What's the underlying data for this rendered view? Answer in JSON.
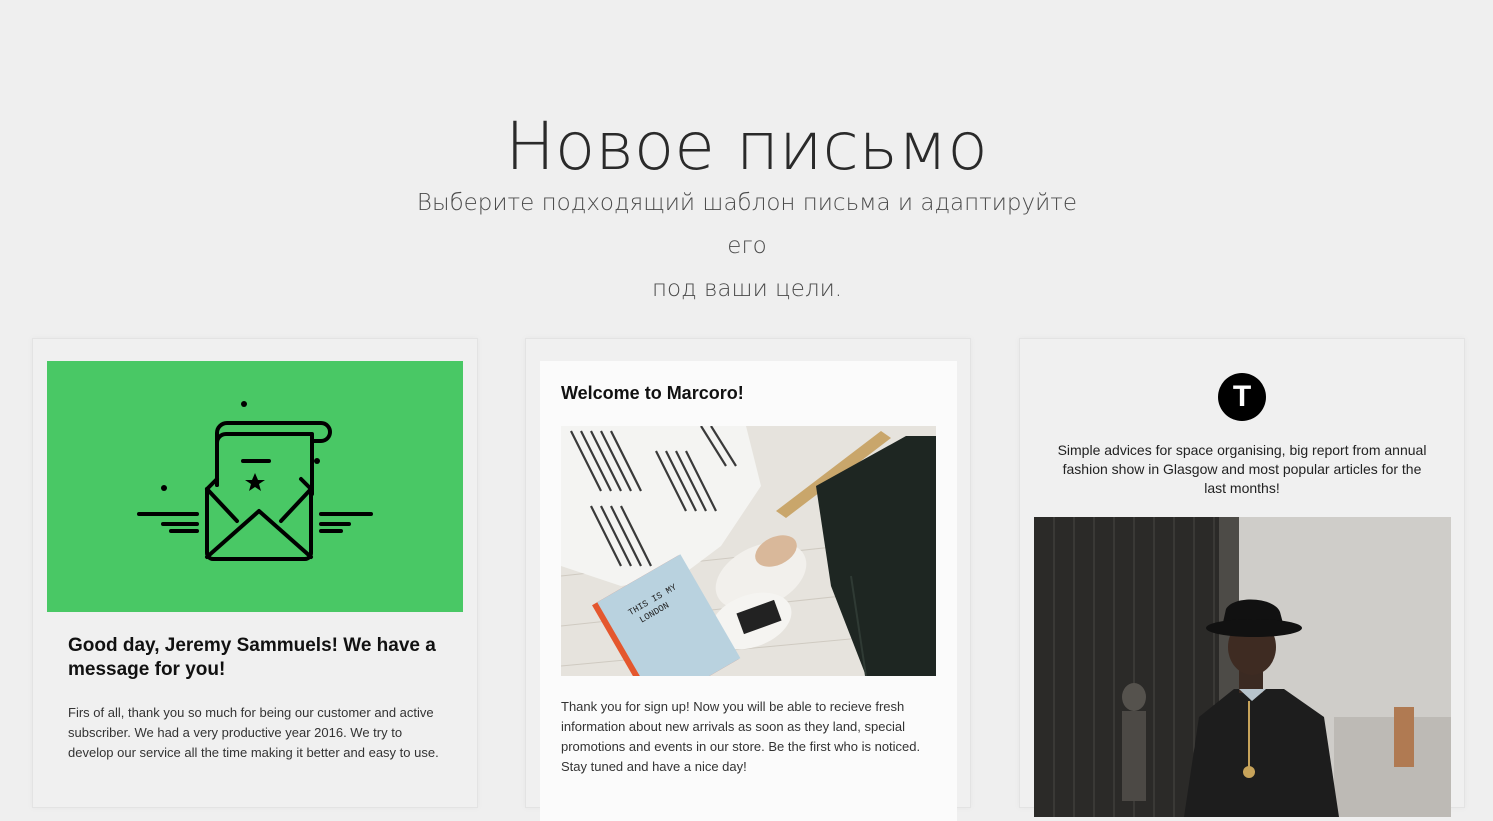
{
  "header": {
    "title": "Новое письмо",
    "subtitle_line1": "Выберите подходящий шаблон письма и адаптируйте его",
    "subtitle_line2": "под ваши цели."
  },
  "templates": [
    {
      "heading": "Good day, Jeremy Sammuels! We have a message for you!",
      "body": "Firs of all, thank you so much for being our customer and active subscriber. We had a very productive year 2016. We try to develop our service all the time making it better and easy to use.",
      "hero_icon": "envelope-letter-icon",
      "hero_color": "#49c865"
    },
    {
      "heading": "Welcome to Marcoro!",
      "body": "Thank you for sign up! Now you will be able to recieve fresh information about new arrivals as soon as they land, special promotions and events in our store. Be the first who is noticed. Stay tuned and have a nice day!",
      "photo": "flatlay-clothes-photo",
      "notebook_text": "THIS IS MY LONDON"
    },
    {
      "logo_letter": "T",
      "text": "Simple advices for space organising, big report from annual fashion show in Glasgow and most popular articles for the last months!",
      "photo": "man-in-hat-photo"
    }
  ],
  "colors": {
    "background": "#efefef",
    "accent_green": "#49c865",
    "logo_black": "#000000"
  }
}
